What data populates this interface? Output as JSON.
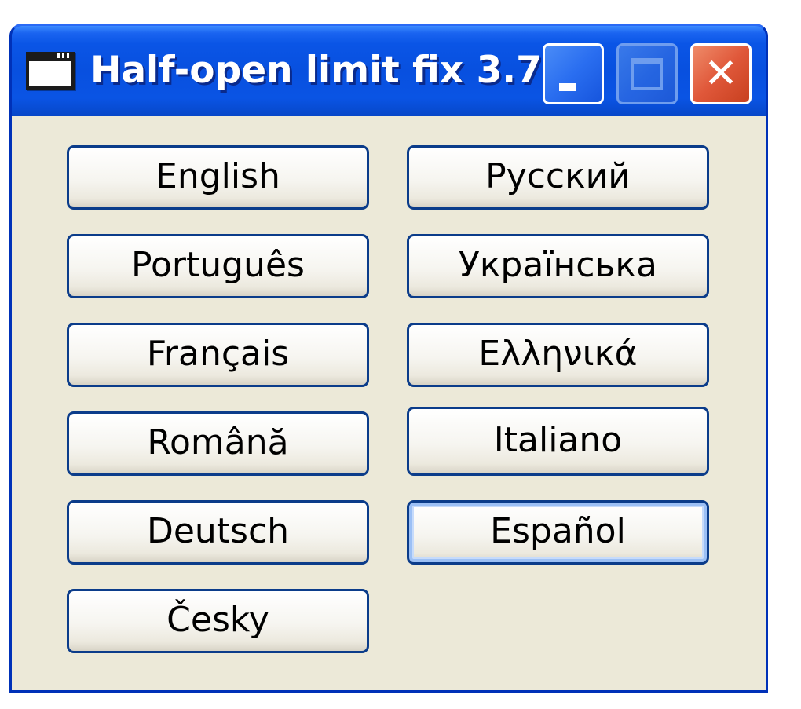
{
  "window": {
    "title": "Half-open limit fix 3.7",
    "title_icon": "app-window-icon",
    "controls": {
      "minimize": "minimize-icon",
      "maximize": "maximize-icon",
      "close": "close-icon",
      "close_glyph": "✕"
    }
  },
  "languages": {
    "left": [
      "English",
      "Português",
      "Français",
      "Română",
      "Deutsch",
      "Česky"
    ],
    "right": [
      "Русский",
      "Українська",
      "Ελληνικά",
      "Italiano",
      "Español"
    ]
  },
  "colors": {
    "titlebar": "#0a55e6",
    "client_background": "#ece9d8",
    "close_button": "#e0583a",
    "button_border": "#0b3c8a"
  }
}
